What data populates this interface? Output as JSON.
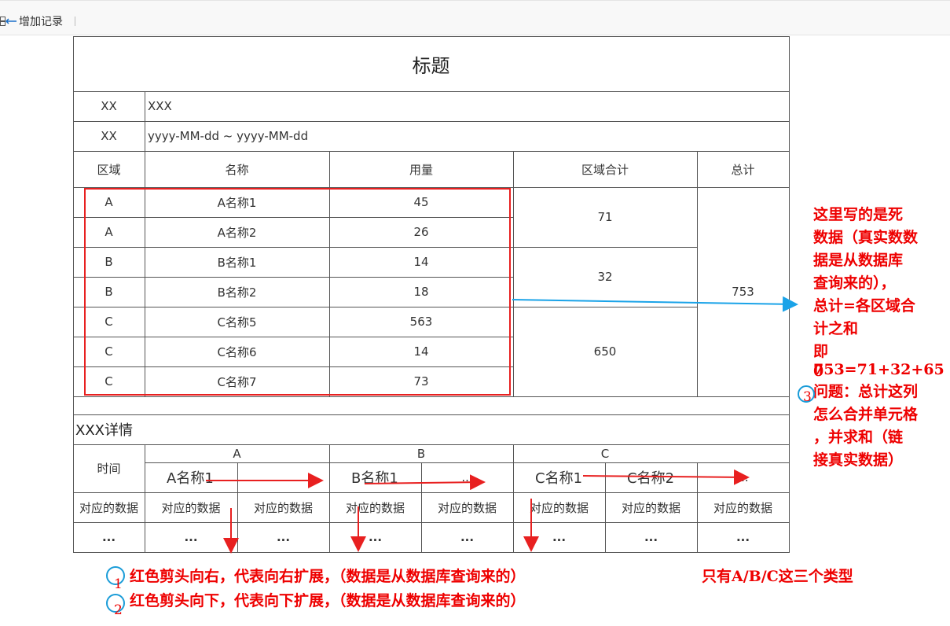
{
  "toolbar": {
    "add_record": "增加记录"
  },
  "report": {
    "title": "标题",
    "row1": {
      "label": "XX",
      "value": "XXX"
    },
    "row2": {
      "label": "XX",
      "value": "yyyy-MM-dd ~ yyyy-MM-dd"
    },
    "headers": {
      "region": "区域",
      "name": "名称",
      "usage": "用量",
      "region_total": "区域合计",
      "total": "总计"
    },
    "rows": [
      {
        "region": "A",
        "name": "A名称1",
        "usage": "45"
      },
      {
        "region": "A",
        "name": "A名称2",
        "usage": "26"
      },
      {
        "region": "B",
        "name": "B名称1",
        "usage": "14"
      },
      {
        "region": "B",
        "name": "B名称2",
        "usage": "18"
      },
      {
        "region": "C",
        "name": "C名称5",
        "usage": "563"
      },
      {
        "region": "C",
        "name": "C名称6",
        "usage": "14"
      },
      {
        "region": "C",
        "name": "C名称7",
        "usage": "73"
      }
    ],
    "region_totals": [
      "71",
      "32",
      "650"
    ],
    "grand_total": "753",
    "detail_title": "XXX详情",
    "detail": {
      "time_label": "时间",
      "groups": [
        "A",
        "B",
        "C"
      ],
      "names": [
        "A名称1",
        "...",
        "B名称1",
        "...",
        "C名称1",
        "C名称2",
        "..."
      ],
      "data_label": "对应的数据",
      "ellipsis": "..."
    }
  },
  "annotations": {
    "side_note": [
      "这里写的是死",
      "数据（真实数数",
      "据是从数据库",
      "查询来的），",
      "总计=各区域合",
      "计之和",
      "即753=71+32+65",
      "0"
    ],
    "question": [
      "问题：总计这列",
      "怎么合并单元格",
      "，并求和（链",
      "接真实数据）"
    ],
    "legend1": "红色剪头向右，代表向右扩展，（数据是从数据库查询来的）",
    "legend2": "红色剪头向下，代表向下扩展，（数据是从数据库查询来的）",
    "types_note": "只有A/B/C这三个类型",
    "marker1": "1",
    "marker2": "2",
    "marker3": "3"
  },
  "colors": {
    "red": "#e82020",
    "blue": "#1aa3e8",
    "grid": "#555555"
  }
}
